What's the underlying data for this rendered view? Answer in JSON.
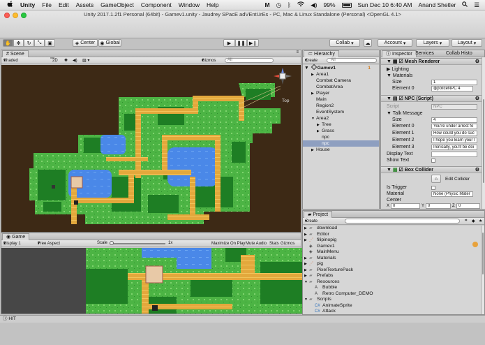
{
  "menubar": {
    "apple": "",
    "app": "Unity",
    "items": [
      "File",
      "Edit",
      "Assets",
      "GameObject",
      "Component",
      "Window",
      "Help"
    ],
    "battery": "99%",
    "datetime": "Sun Dec 10  6:40 AM",
    "user": "Anand Shetler"
  },
  "window": {
    "title": "Unity 2017.1.2f1 Personal (64bit) - Gamev1.unity - Jaudrey SPacE adVEntUrEs - PC, Mac & Linux Standalone (Personal) <OpenGL 4.1>"
  },
  "toolbar": {
    "pivot": "Center",
    "space": "Global",
    "collab": "Collab",
    "account": "Account",
    "layers": "Layers",
    "layout": "Layout"
  },
  "scene": {
    "tab": "Scene",
    "shading": "Shaded",
    "mode2d": "2D",
    "gizmos": "Gizmos",
    "search_placeholder": "All",
    "gizmo_label": "Top"
  },
  "game": {
    "tab": "Game",
    "display": "Display 1",
    "aspect": "Free Aspect",
    "scale_label": "Scale",
    "scale_value": "1x",
    "maximize": "Maximize On Play",
    "mute": "Mute Audio",
    "stats": "Stats",
    "gizmos": "Gizmos"
  },
  "hierarchy": {
    "tab": "Hierarchy",
    "create": "Create",
    "search_placeholder": "All",
    "scene_name": "Gamev1",
    "scene_badge": "1",
    "items": [
      {
        "label": "Area1",
        "indent": 1,
        "arrow": "▶",
        "selected": false
      },
      {
        "label": "Combat Camera",
        "indent": 1,
        "arrow": "",
        "selected": false
      },
      {
        "label": "CombatArea",
        "indent": 1,
        "arrow": "",
        "selected": false
      },
      {
        "label": "Player",
        "indent": 1,
        "arrow": "▶",
        "selected": false
      },
      {
        "label": "Main",
        "indent": 1,
        "arrow": "",
        "selected": false
      },
      {
        "label": "Region2",
        "indent": 1,
        "arrow": "",
        "selected": false
      },
      {
        "label": "EventSystem",
        "indent": 1,
        "arrow": "",
        "selected": false
      },
      {
        "label": "Area2",
        "indent": 1,
        "arrow": "▼",
        "selected": false
      },
      {
        "label": "Tree",
        "indent": 2,
        "arrow": "▶",
        "selected": false
      },
      {
        "label": "Grass",
        "indent": 2,
        "arrow": "▶",
        "selected": false
      },
      {
        "label": "npc",
        "indent": 2,
        "arrow": "",
        "selected": false
      },
      {
        "label": "npc",
        "indent": 2,
        "arrow": "",
        "selected": true
      },
      {
        "label": "House",
        "indent": 1,
        "arrow": "▶",
        "selected": false
      }
    ]
  },
  "inspector": {
    "tabs": [
      "Inspector",
      "Services",
      "Collab Histo"
    ],
    "mesh_renderer": {
      "title": "Mesh Renderer",
      "lighting": "Lighting",
      "materials": "Materials",
      "size_label": "Size",
      "size_value": "1",
      "element0_label": "Element 0",
      "element0_value": "policeNPC 4"
    },
    "npc_script": {
      "title": "NPC (Script)",
      "script_label": "Script",
      "script_value": "NPC",
      "talk_label": "Talk Message",
      "size_label": "Size",
      "size_value": "4",
      "elements": [
        {
          "label": "Element 0",
          "value": "You're under arrest fo"
        },
        {
          "label": "Element 1",
          "value": "How could you do suc"
        },
        {
          "label": "Element 2",
          "value": "I hope you learn your l"
        },
        {
          "label": "Element 3",
          "value": "Ironically, you'll be doi"
        }
      ],
      "display_text": "Display Text",
      "show_text": "Show Text"
    },
    "box_collider": {
      "title": "Box Collider",
      "edit_label": "Edit Collider",
      "trigger_label": "Is Trigger",
      "material_label": "Material",
      "material_value": "None (Physic Mater",
      "center_label": "Center",
      "x_label": "X",
      "x_value": "0",
      "y_label": "Y",
      "y_value": "0",
      "z_label": "Z",
      "z_value": "0"
    }
  },
  "project": {
    "tab": "Project",
    "create": "Create",
    "items": [
      {
        "label": "download",
        "indent": 0,
        "arrow": "▶",
        "type": "folder"
      },
      {
        "label": "Editor",
        "indent": 0,
        "arrow": "▶",
        "type": "folder"
      },
      {
        "label": "filipinopig",
        "indent": 0,
        "arrow": "▶",
        "type": "file"
      },
      {
        "label": "Gamev1",
        "indent": 0,
        "arrow": "",
        "type": "unity"
      },
      {
        "label": "MainMenu",
        "indent": 0,
        "arrow": "",
        "type": "unity"
      },
      {
        "label": "Materials",
        "indent": 0,
        "arrow": "▶",
        "type": "folder"
      },
      {
        "label": "pig",
        "indent": 0,
        "arrow": "▶",
        "type": "file"
      },
      {
        "label": "PixelTexturePack",
        "indent": 0,
        "arrow": "▶",
        "type": "folder"
      },
      {
        "label": "Prefabs",
        "indent": 0,
        "arrow": "▶",
        "type": "folder"
      },
      {
        "label": "Resources",
        "indent": 0,
        "arrow": "▼",
        "type": "folder"
      },
      {
        "label": "Bubble",
        "indent": 1,
        "arrow": "",
        "type": "asset"
      },
      {
        "label": "Retro Computer_DEMO",
        "indent": 1,
        "arrow": "",
        "type": "asset"
      },
      {
        "label": "Scripts",
        "indent": 0,
        "arrow": "▼",
        "type": "folder"
      },
      {
        "label": "AnimateSprite",
        "indent": 1,
        "arrow": "",
        "type": "script"
      },
      {
        "label": "Attack",
        "indent": 1,
        "arrow": "",
        "type": "script"
      }
    ]
  },
  "status": {
    "message": "HIT"
  },
  "colors": {
    "grass": "#3fa63d",
    "path": "#e2a63b",
    "water": "#4a88e8",
    "earth": "#3d2915",
    "selection": "#8e9fc0"
  }
}
